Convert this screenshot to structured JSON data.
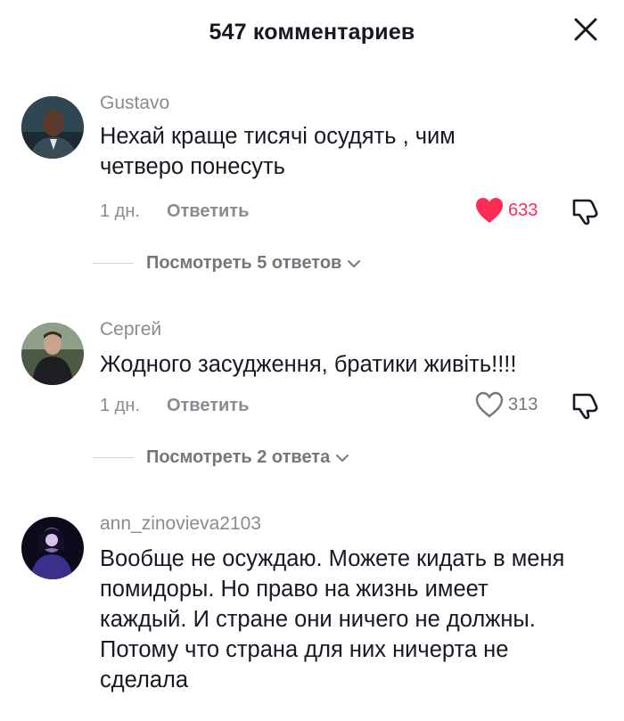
{
  "header": {
    "title": "547 комментариев"
  },
  "comments": [
    {
      "username": "Gustavo",
      "text": "Нехай краще тисячі осудять , чим четверо понесуть",
      "time": "1 дн.",
      "reply_label": "Ответить",
      "likes": "633",
      "liked": true,
      "view_replies": "Посмотреть 5 ответов"
    },
    {
      "username": "Сергей",
      "text": "Жодного засудження, братики живіть!!!!",
      "time": "1 дн.",
      "reply_label": "Ответить",
      "likes": "313",
      "liked": false,
      "view_replies": "Посмотреть 2 ответа"
    },
    {
      "username": "ann_zinovieva2103",
      "text": "Вообще не осуждаю. Можете кидать в меня помидоры. Но право на жизнь имеет каждый. И стране они ничего не должны. Потому что страна для них ничерта не сделала"
    }
  ],
  "colors": {
    "like_red": "#fe2c55",
    "muted": "#8a8b91"
  },
  "icons": [
    "close-icon",
    "heart-filled-icon",
    "heart-outline-icon",
    "dislike-icon",
    "chevron-down-icon"
  ]
}
